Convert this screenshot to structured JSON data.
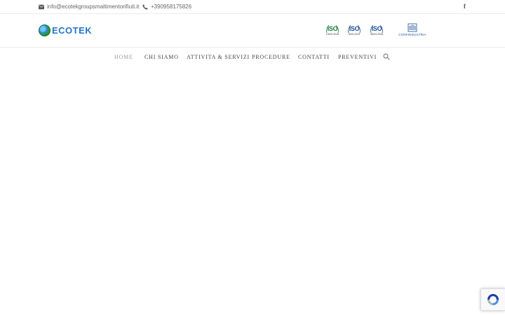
{
  "topbar": {
    "email": "info@ecotekgroupsmaltimentorifiuti.it",
    "phone": "+390958175826",
    "social": [
      {
        "icon": "facebook-icon",
        "label": "f"
      }
    ]
  },
  "header": {
    "logo": {
      "wordmark": "ECOTEK"
    },
    "certifications": [
      {
        "mark": "ISO",
        "standard": "14001:2015"
      },
      {
        "mark": "ISO",
        "standard": "9001:2015"
      },
      {
        "mark": "ISO",
        "standard": "45001:2018"
      }
    ],
    "association": "CONFINDUSTRIA"
  },
  "nav": {
    "items": [
      {
        "label": "HOME",
        "active": true
      },
      {
        "label": "CHI SIAMO",
        "active": false
      },
      {
        "label": "ATTIVITA & SERVIZI",
        "active": false
      },
      {
        "label": "PROCEDURE",
        "active": false
      },
      {
        "label": "CONTATTI",
        "active": false
      },
      {
        "label": "PREVENTIVI",
        "active": false
      }
    ],
    "search_icon": "search-icon"
  },
  "colors": {
    "brand_blue": "#2276c8",
    "brand_green": "#1a7a3a",
    "nav_text": "#444444",
    "nav_active": "#9a9a9a"
  }
}
